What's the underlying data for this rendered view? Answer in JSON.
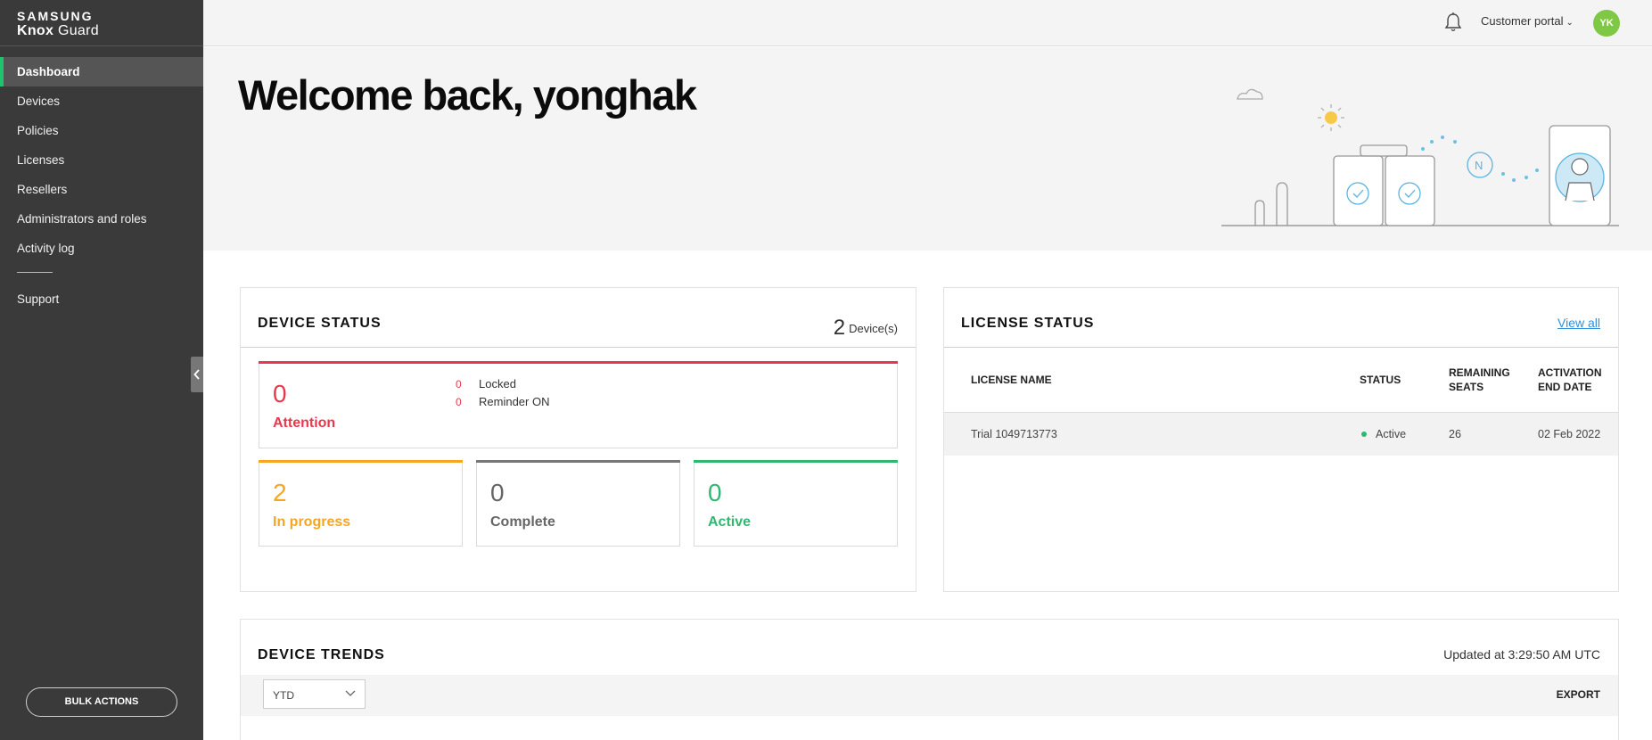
{
  "brand": {
    "line1": "SAMSUNG",
    "line2_bold": "Knox",
    "line2_rest": " Guard"
  },
  "sidebar": {
    "items": [
      {
        "label": "Dashboard"
      },
      {
        "label": "Devices"
      },
      {
        "label": "Policies"
      },
      {
        "label": "Licenses"
      },
      {
        "label": "Resellers"
      },
      {
        "label": "Administrators and roles"
      },
      {
        "label": "Activity log"
      }
    ],
    "support": "Support",
    "bulk_actions": "BULK ACTIONS",
    "collapse_icon": "chevron-left-icon"
  },
  "topbar": {
    "portal": "Customer portal",
    "avatar": "YK",
    "avatar_color": "#7ec843",
    "bell_icon": "bell-icon"
  },
  "hero": {
    "welcome": "Welcome back, yonghak"
  },
  "device_status": {
    "title": "DEVICE STATUS",
    "count": "2",
    "count_unit": "Device(s)",
    "attention": {
      "value": "0",
      "label": "Attention",
      "color": "#e8384f"
    },
    "locked": {
      "value": "0",
      "label": "Locked"
    },
    "reminder": {
      "value": "0",
      "label": "Reminder ON"
    },
    "in_progress": {
      "value": "2",
      "label": "In progress",
      "color": "#f5a623"
    },
    "complete": {
      "value": "0",
      "label": "Complete",
      "color": "#666666"
    },
    "active": {
      "value": "0",
      "label": "Active",
      "color": "#2eb872"
    }
  },
  "license_status": {
    "title": "LICENSE STATUS",
    "view_all": "View all",
    "columns": {
      "name": "LICENSE NAME",
      "status": "STATUS",
      "remaining_1": "REMAINING",
      "remaining_2": "SEATS",
      "activation_1": "ACTIVATION",
      "activation_2": "END DATE"
    },
    "rows": [
      {
        "name": "Trial 1049713773",
        "status": "Active",
        "seats": "26",
        "end_date": "02 Feb 2022"
      }
    ]
  },
  "device_trends": {
    "title": "DEVICE TRENDS",
    "updated": "Updated at 3:29:50 AM UTC",
    "range": "YTD",
    "export": "EXPORT"
  }
}
